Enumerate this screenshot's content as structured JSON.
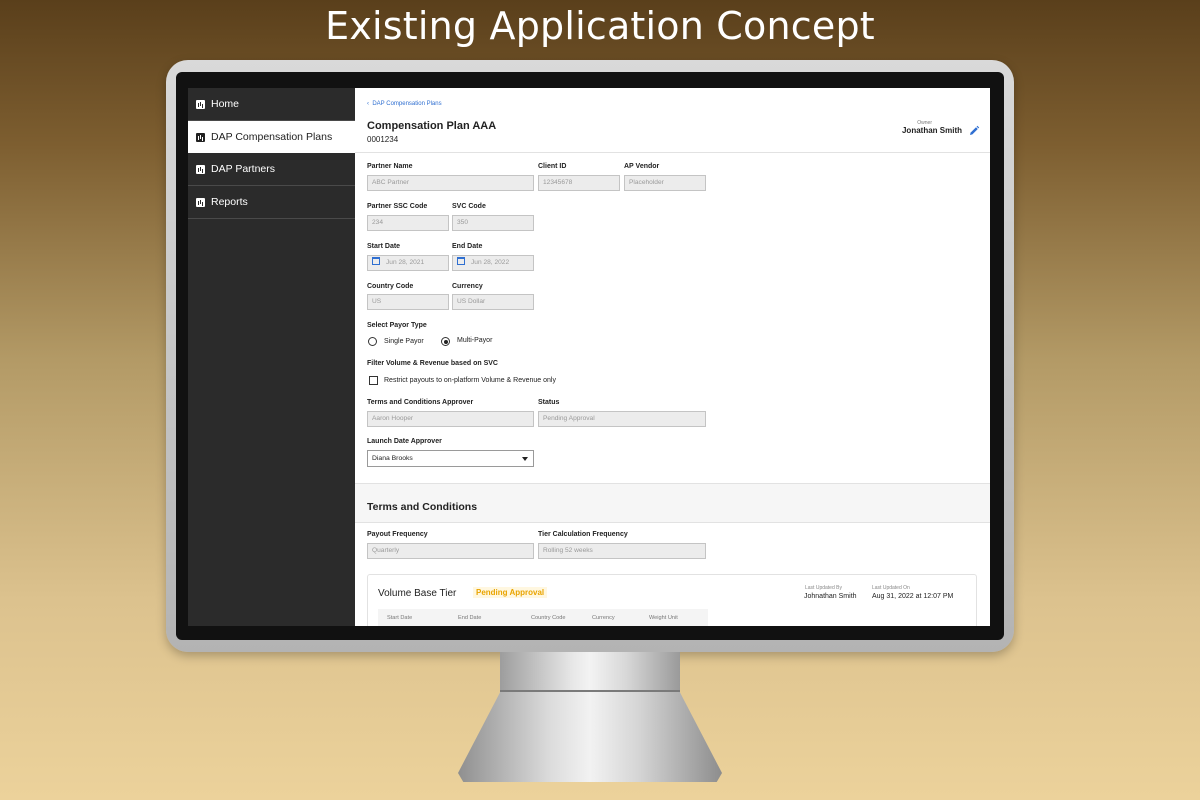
{
  "headline": "Existing Application Concept",
  "sidebar": {
    "items": [
      {
        "label": "Home"
      },
      {
        "label": "DAP Compensation Plans",
        "active": true
      },
      {
        "label": "DAP Partners"
      },
      {
        "label": "Reports"
      }
    ]
  },
  "header": {
    "breadcrumb": "DAP Compensation Plans",
    "title": "Compensation Plan AAA",
    "plan_id": "0001234",
    "owner_label": "Owner",
    "owner_name": "Jonathan Smith"
  },
  "form": {
    "partner_name": {
      "label": "Partner Name",
      "value": "ABC Partner"
    },
    "client_id": {
      "label": "Client ID",
      "value": "12345678"
    },
    "ap_vendor": {
      "label": "AP Vendor",
      "value": "Placeholder"
    },
    "partner_ssc_code": {
      "label": "Partner SSC Code",
      "value": "234"
    },
    "svc_code": {
      "label": "SVC Code",
      "value": "350"
    },
    "start_date": {
      "label": "Start Date",
      "value": "Jun 28, 2021"
    },
    "end_date": {
      "label": "End Date",
      "value": "Jun 28, 2022"
    },
    "country_code": {
      "label": "Country Code",
      "value": "US"
    },
    "currency": {
      "label": "Currency",
      "value": "US Dollar"
    },
    "payor_type": {
      "label": "Select Payor Type",
      "options": [
        "Single Payor",
        "Multi-Payor"
      ],
      "selected": "Multi-Payor"
    },
    "filter": {
      "label": "Filter Volume & Revenue based on SVC",
      "checkbox_label": "Restrict payouts to on-platform Volume & Revenue only",
      "checked": false
    },
    "tc_approver": {
      "label": "Terms and Conditions Approver",
      "value": "Aaron Hooper"
    },
    "status": {
      "label": "Status",
      "value": "Pending Approval"
    },
    "launch_approver": {
      "label": "Launch Date Approver",
      "value": "Diana Brooks"
    }
  },
  "terms": {
    "title": "Terms and Conditions",
    "payout_frequency": {
      "label": "Payout Frequency",
      "value": "Quarterly"
    },
    "tier_calc_frequency": {
      "label": "Tier Calculation Frequency",
      "value": "Rolling 52 weeks"
    }
  },
  "tier_card": {
    "title": "Volume Base Tier",
    "badge": "Pending Approval",
    "updated_by_label": "Last Updated By",
    "updated_by": "Johnathan Smith",
    "updated_on_label": "Last Updated On",
    "updated_on": "Aug 31, 2022 at 12:07 PM",
    "columns": [
      "Start Date",
      "End Date",
      "Country Code",
      "Currency",
      "Weight Unit"
    ]
  },
  "colors": {
    "accent": "#2f6fd1",
    "sidebar_bg": "#2b2b2b",
    "badge": "#e9a400"
  }
}
